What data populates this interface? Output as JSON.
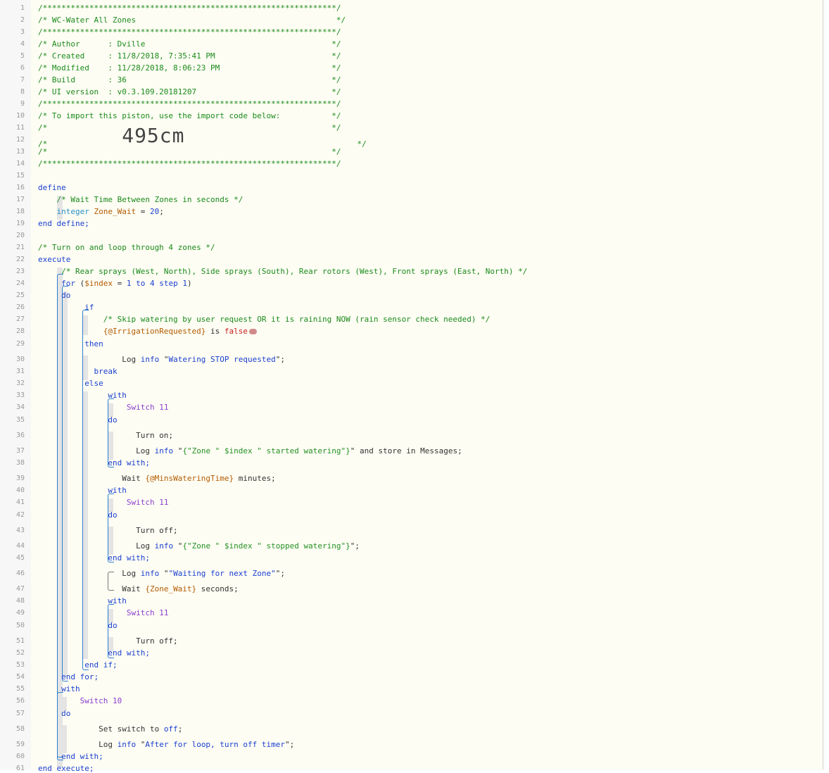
{
  "piston_code_lines": [
    [
      [
        "c",
        "/***************************************************************/"
      ]
    ],
    [
      [
        "c",
        "/* WC-Water All Zones                                           */"
      ]
    ],
    [
      [
        "c",
        "/***************************************************************/"
      ]
    ],
    [
      [
        "c",
        "/* Author      : Dville                                        */"
      ]
    ],
    [
      [
        "c",
        "/* Created     : 11/8/2018, 7:35:41 PM                         */"
      ]
    ],
    [
      [
        "c",
        "/* Modified    : 11/28/2018, 8:06:23 PM                        */"
      ]
    ],
    [
      [
        "c",
        "/* Build       : 36                                            */"
      ]
    ],
    [
      [
        "c",
        "/* UI version  : v0.3.109.20181207                             */"
      ]
    ],
    [
      [
        "c",
        "/***************************************************************/"
      ]
    ],
    [
      [
        "c",
        "/* To import this piston, use the import code below:           */"
      ]
    ],
    [
      [
        "c",
        "/*                                                             */"
      ]
    ],
    [
      [
        "c",
        "/*                "
      ],
      [
        "big",
        "495cm"
      ],
      [
        "c",
        "                                     */"
      ]
    ],
    [
      [
        "c",
        "/*                                                             */"
      ]
    ],
    [
      [
        "c",
        "/***************************************************************/"
      ]
    ],
    [],
    [
      [
        "k",
        "define"
      ]
    ],
    [
      [
        "x",
        "    "
      ],
      [
        "c",
        "/* Wait Time Between Zones in seconds */"
      ]
    ],
    [
      [
        "x",
        "    "
      ],
      [
        "t",
        "integer"
      ],
      [
        "x",
        " "
      ],
      [
        "v",
        "Zone_Wait"
      ],
      [
        "x",
        " = "
      ],
      [
        "n",
        "20"
      ],
      [
        "x",
        ";"
      ]
    ],
    [
      [
        "k",
        "end define;"
      ]
    ],
    [],
    [
      [
        "c",
        "/* Turn on and loop through 4 zones */"
      ]
    ],
    [
      [
        "k",
        "execute"
      ]
    ],
    [
      [
        "x",
        "     "
      ],
      [
        "c",
        "/* Rear sprays (West, North), Side sprays (South), Rear rotors (West), Front sprays (East, North) */"
      ]
    ],
    [
      [
        "x",
        "     "
      ],
      [
        "k",
        "for"
      ],
      [
        "x",
        " ("
      ],
      [
        "v",
        "$index"
      ],
      [
        "x",
        " = "
      ],
      [
        "n",
        "1"
      ],
      [
        "x",
        " "
      ],
      [
        "k",
        "to"
      ],
      [
        "x",
        " "
      ],
      [
        "n",
        "4"
      ],
      [
        "x",
        " "
      ],
      [
        "k",
        "step"
      ],
      [
        "x",
        " "
      ],
      [
        "n",
        "1"
      ],
      [
        "x",
        ")"
      ]
    ],
    [
      [
        "x",
        "     "
      ],
      [
        "k",
        "do"
      ]
    ],
    [
      [
        "x",
        "          "
      ],
      [
        "k",
        "if"
      ]
    ],
    [
      [
        "x",
        "              "
      ],
      [
        "c",
        "/* Skip watering by user request OR it is raining NOW (rain sensor check needed) */"
      ]
    ],
    [
      [
        "x",
        "              "
      ],
      [
        "e",
        "{@IrrigationRequested}"
      ],
      [
        "x",
        " is "
      ],
      [
        "f",
        "false"
      ],
      [
        "pill",
        ""
      ]
    ],
    [
      [
        "x",
        "          "
      ],
      [
        "k",
        "then"
      ]
    ],
    [
      [
        "x",
        "                  Log "
      ],
      [
        "k",
        "info"
      ],
      [
        "x",
        " \""
      ],
      [
        "s",
        "Watering STOP requested"
      ],
      [
        "x",
        "\";"
      ]
    ],
    [
      [
        "x",
        "          "
      ],
      [
        "x",
        "  "
      ],
      [
        "k",
        "break"
      ]
    ],
    [
      [
        "x",
        "          "
      ],
      [
        "k",
        "else"
      ]
    ],
    [
      [
        "x",
        "               "
      ],
      [
        "k",
        "with"
      ]
    ],
    [
      [
        "x",
        "                   "
      ],
      [
        "d",
        "Switch 11"
      ]
    ],
    [
      [
        "x",
        "               "
      ],
      [
        "k",
        "do"
      ]
    ],
    [
      [
        "x",
        "                     Turn on;"
      ]
    ],
    [
      [
        "x",
        "                     Log "
      ],
      [
        "k",
        "info"
      ],
      [
        "x",
        " \""
      ],
      [
        "sg",
        "{\"Zone \" $index \" started watering\"}"
      ],
      [
        "x",
        "\" and store in Messages;"
      ]
    ],
    [
      [
        "x",
        "               "
      ],
      [
        "k",
        "end with;"
      ]
    ],
    [
      [
        "x",
        "                  Wait "
      ],
      [
        "e",
        "{@MinsWateringTime}"
      ],
      [
        "x",
        " minutes;"
      ]
    ],
    [
      [
        "x",
        "               "
      ],
      [
        "k",
        "with"
      ]
    ],
    [
      [
        "x",
        "                   "
      ],
      [
        "d",
        "Switch 11"
      ]
    ],
    [
      [
        "x",
        "               "
      ],
      [
        "k",
        "do"
      ]
    ],
    [
      [
        "x",
        "                     Turn off;"
      ]
    ],
    [
      [
        "x",
        "                     Log "
      ],
      [
        "k",
        "info"
      ],
      [
        "x",
        " \""
      ],
      [
        "sg",
        "{\"Zone \" $index \" stopped watering\"}"
      ],
      [
        "x",
        "\";"
      ]
    ],
    [
      [
        "x",
        "               "
      ],
      [
        "k",
        "end with;"
      ]
    ],
    [
      [
        "x",
        "                  Log "
      ],
      [
        "k",
        "info"
      ],
      [
        "x",
        " \""
      ],
      [
        "s",
        "\"Waiting for next Zone\""
      ],
      [
        "x",
        "\";"
      ]
    ],
    [
      [
        "x",
        "                  Wait "
      ],
      [
        "e",
        "{Zone_Wait}"
      ],
      [
        "x",
        " seconds;"
      ]
    ],
    [
      [
        "x",
        "               "
      ],
      [
        "k",
        "with"
      ]
    ],
    [
      [
        "x",
        "                   "
      ],
      [
        "d",
        "Switch 11"
      ]
    ],
    [
      [
        "x",
        "               "
      ],
      [
        "k",
        "do"
      ]
    ],
    [
      [
        "x",
        "                     Turn off;"
      ]
    ],
    [
      [
        "x",
        "               "
      ],
      [
        "k",
        "end with;"
      ]
    ],
    [
      [
        "x",
        "          "
      ],
      [
        "k",
        "end if;"
      ]
    ],
    [
      [
        "x",
        "     "
      ],
      [
        "k",
        "end for;"
      ]
    ],
    [
      [
        "x",
        "     "
      ],
      [
        "k",
        "with"
      ]
    ],
    [
      [
        "x",
        "         "
      ],
      [
        "d",
        "Switch 10"
      ]
    ],
    [
      [
        "x",
        "     "
      ],
      [
        "k",
        "do"
      ]
    ],
    [
      [
        "x",
        "             Set switch to "
      ],
      [
        "k",
        "off"
      ],
      [
        "x",
        ";"
      ]
    ],
    [
      [
        "x",
        "             Log "
      ],
      [
        "k",
        "info"
      ],
      [
        "x",
        " \""
      ],
      [
        "s",
        "After for loop, turn off timer"
      ],
      [
        "x",
        "\";"
      ]
    ],
    [
      [
        "x",
        "     "
      ],
      [
        "k",
        "end with;"
      ]
    ],
    [
      [
        "k",
        "end execute;"
      ]
    ]
  ],
  "line_numbers": [
    "1",
    "2",
    "3",
    "4",
    "5",
    "6",
    "7",
    "8",
    "9",
    "10",
    "11",
    "12",
    "13",
    "14",
    "15",
    "16",
    "17",
    "18",
    "19",
    "20",
    "21",
    "22",
    "23",
    "24",
    "25",
    "26",
    "27",
    "28",
    "29",
    "30",
    "31",
    "32",
    "33",
    "34",
    "35",
    "36",
    "37",
    "38",
    "39",
    "40",
    "41",
    "42",
    "43",
    "44",
    "45",
    "46",
    "47",
    "48",
    "49",
    "50",
    "51",
    "52",
    "53",
    "54",
    "55",
    "56",
    "57",
    "58",
    "59",
    "60",
    "61"
  ],
  "colors": {
    "comment": "#1b8a1b",
    "keyword": "#1a3fd0",
    "type": "#2a8fc4",
    "variable": "#b35a00",
    "device": "#8a3ecf",
    "false": "#c81e1e",
    "bracket": "#2d7fd0",
    "background": "#fdfdf3"
  }
}
